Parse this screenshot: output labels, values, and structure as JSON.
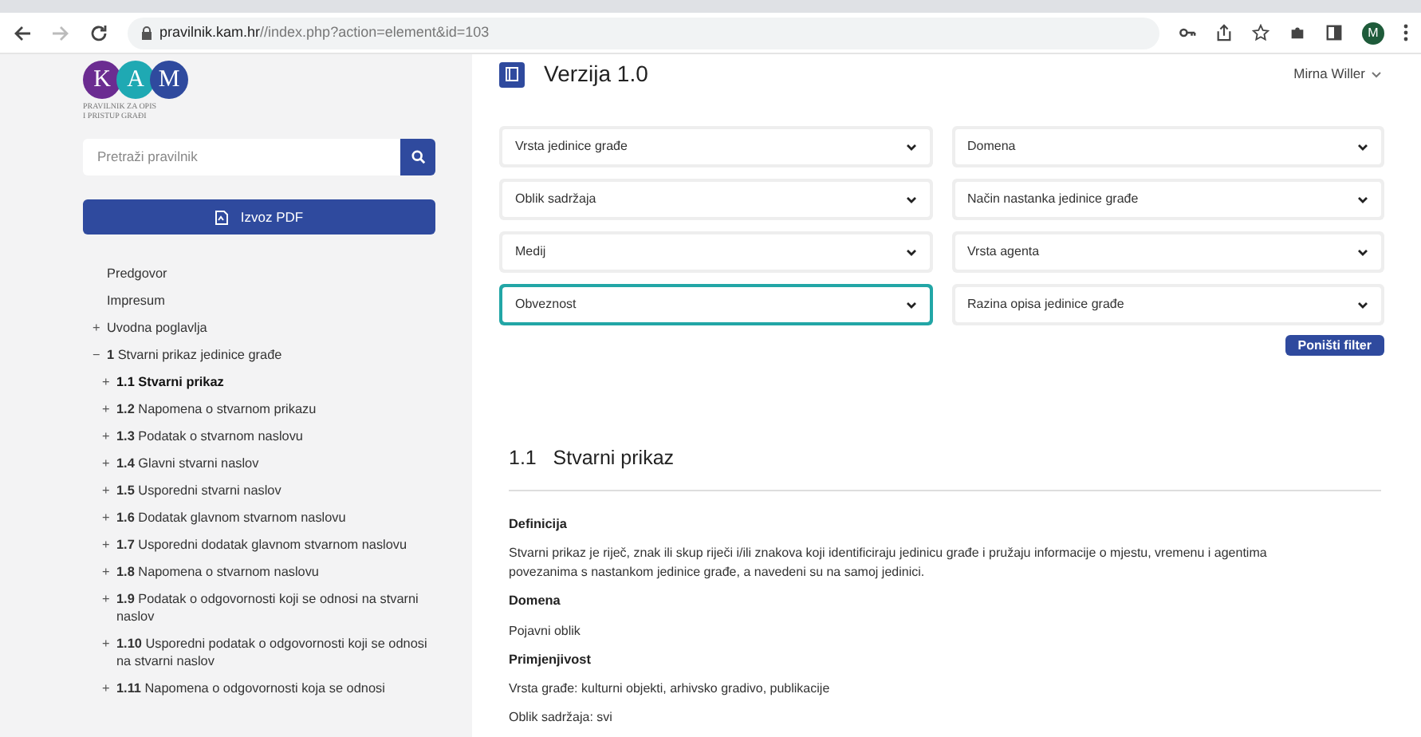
{
  "browser": {
    "url_host": "pravilnik.kam.hr",
    "url_path": "//index.php?action=element&id=103",
    "profile_initial": "M"
  },
  "sidebar": {
    "logo_letters": [
      "K",
      "A",
      "M"
    ],
    "logo_caption": [
      "PRAVILNIK ZA OPIS",
      "I PRISTUP GRAĐI"
    ],
    "search": {
      "placeholder": "Pretraži pravilnik"
    },
    "export_button": "Izvoz PDF",
    "nav": [
      {
        "label": "Predgovor",
        "selected": false
      },
      {
        "label": "Impresum",
        "selected": false
      },
      {
        "toggle": "+",
        "label": "Uvodna poglavlja",
        "selected": false
      },
      {
        "toggle": "−",
        "label": "**1** Stvarni prikaz jedinice građe",
        "selected": false,
        "children": [
          {
            "toggle": "+",
            "label": "1.1 Stvarni prikaz",
            "selected": true
          },
          {
            "toggle": "+",
            "label": "**1.2** Napomena o stvarnom prikazu",
            "selected": false
          },
          {
            "toggle": "+",
            "label": "**1.3** Podatak o stvarnom naslovu",
            "selected": false
          },
          {
            "toggle": "+",
            "label": "**1.4** Glavni stvarni naslov",
            "selected": false
          },
          {
            "toggle": "+",
            "label": "**1.5** Usporedni stvarni naslov",
            "selected": false
          },
          {
            "toggle": "+",
            "label": "**1.6** Dodatak glavnom stvarnom naslovu",
            "selected": false
          },
          {
            "toggle": "+",
            "label": "**1.7** Usporedni dodatak glavnom stvarnom naslovu",
            "selected": false
          },
          {
            "toggle": "+",
            "label": "**1.8** Napomena o stvarnom naslovu",
            "selected": false
          },
          {
            "toggle": "+",
            "label": "**1.9** Podatak o odgovornosti koji se odnosi na stvarni naslov",
            "selected": false
          },
          {
            "toggle": "+",
            "label": "**1.10** Usporedni podatak o odgovornosti koji se odnosi na stvarni naslov",
            "selected": false
          },
          {
            "toggle": "+",
            "label": "**1.11** Napomena o odgovornosti koja se odnosi",
            "selected": false
          }
        ]
      }
    ]
  },
  "header": {
    "title": "Verzija 1.0",
    "user": "Mirna Willer"
  },
  "filters": [
    {
      "label": "Vrsta jedinice građe",
      "focused": false
    },
    {
      "label": "Domena",
      "focused": false
    },
    {
      "label": "Oblik sadržaja",
      "focused": false
    },
    {
      "label": "Način nastanka jedinice građe",
      "focused": false
    },
    {
      "label": "Medij",
      "focused": false
    },
    {
      "label": "Vrsta agenta",
      "focused": false
    },
    {
      "label": "Obveznost",
      "focused": true
    },
    {
      "label": "Razina opisa jedinice građe",
      "focused": false
    }
  ],
  "reset_button": "Poništi filter",
  "element": {
    "number": "1.1",
    "title": "Stvarni prikaz",
    "sections": [
      {
        "heading": "Definicija",
        "paragraphs": [
          "Stvarni prikaz je riječ, znak ili skup riječi i/ili znakova koji identificiraju jedinicu građe i pružaju informacije o mjestu, vremenu i agentima povezanima s nastankom jedinice građe, a navedeni su na samoj jedinici."
        ]
      },
      {
        "heading": "Domena",
        "paragraphs": [
          "Pojavni oblik"
        ]
      },
      {
        "heading": "Primjenjivost",
        "paragraphs": [
          "Vrsta građe: kulturni objekti, arhivsko gradivo, publikacije",
          "Oblik sadržaja: svi"
        ]
      }
    ]
  }
}
